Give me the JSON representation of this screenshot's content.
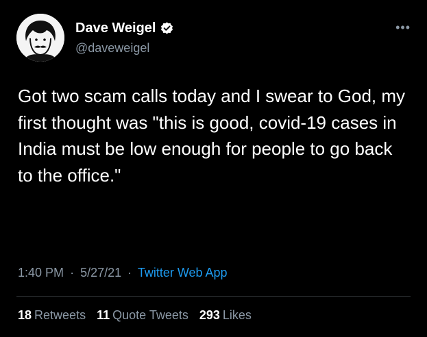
{
  "author": {
    "display_name": "Dave Weigel",
    "handle": "@daveweigel",
    "verified_icon": "verified-badge-icon",
    "avatar_icon": "caricature-avatar"
  },
  "more_icon": "more-options-icon",
  "tweet": {
    "text": "Got two scam calls today and I swear to God, my first thought was \"this is good, covid-19 cases in India must be low enough for people to go back to the office.\""
  },
  "meta": {
    "time": "1:40 PM",
    "date": "5/27/21",
    "separator": "·",
    "source": "Twitter Web App"
  },
  "stats": {
    "retweets_count": "18",
    "retweets_label": "Retweets",
    "quote_count": "11",
    "quote_label": "Quote Tweets",
    "likes_count": "293",
    "likes_label": "Likes"
  },
  "colors": {
    "background": "#000000",
    "text": "#ffffff",
    "secondary": "#8b98a5",
    "link": "#1d9bf0"
  }
}
